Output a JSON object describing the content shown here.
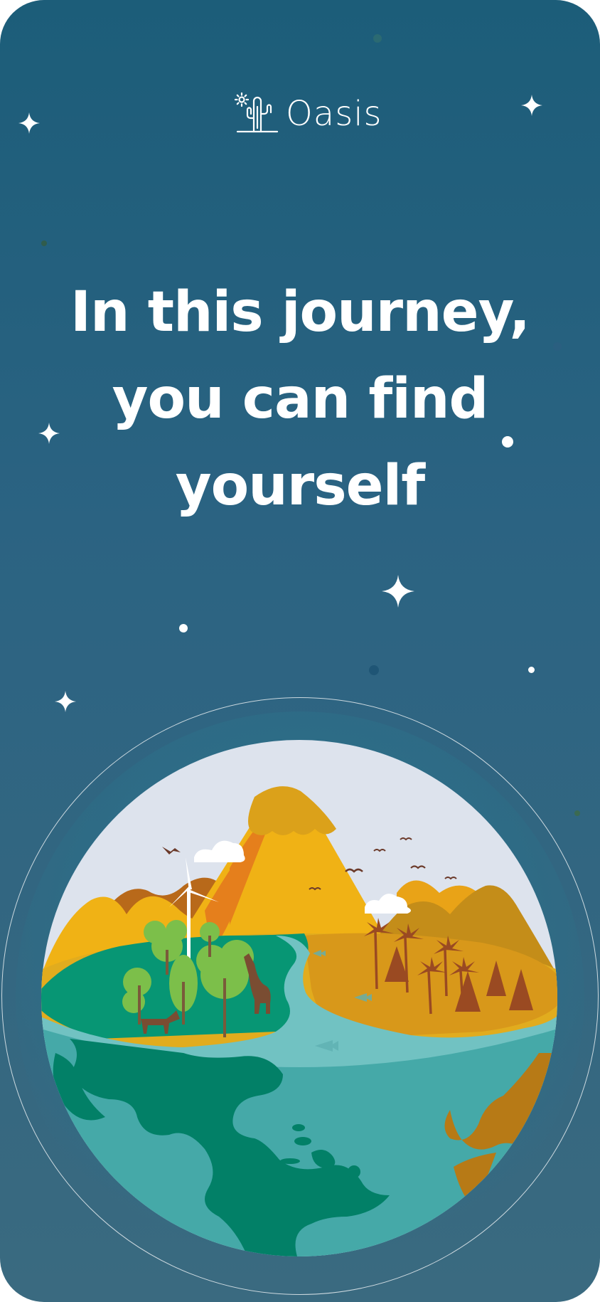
{
  "app": {
    "name": "Oasis"
  },
  "headline": {
    "line1": "In this journey,",
    "line2": "you can find",
    "line3": "yourself"
  },
  "colors": {
    "background_top": "#1c5d79",
    "background_bottom": "#3a6a80",
    "text": "#ffffff",
    "sky": "#dde3ed",
    "ocean": "#45a9a8",
    "land_green": "#028067",
    "forest_green": "#079674",
    "mountain_yellow": "#f0b215",
    "mountain_orange": "#e57f1c",
    "desert_brown": "#b77a16"
  },
  "icons": {
    "logo": "cactus-sun-icon",
    "stars": "sparkle-star-icon"
  }
}
